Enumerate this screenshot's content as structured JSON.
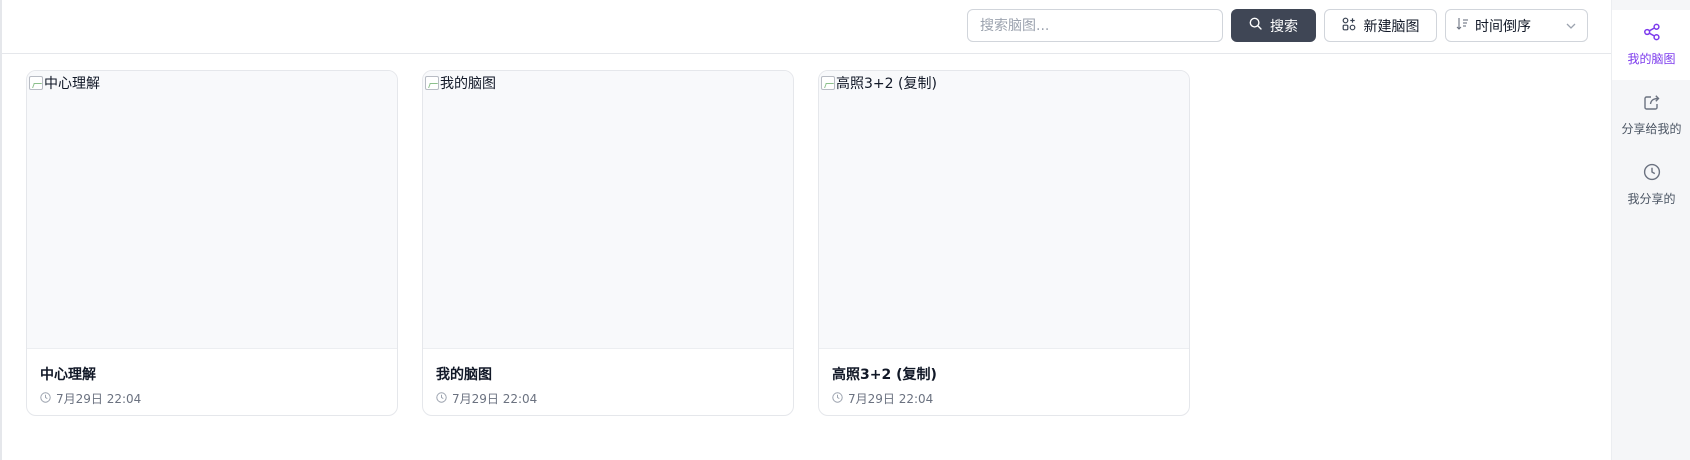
{
  "toolbar": {
    "search_placeholder": "搜索脑图...",
    "search_label": "搜索",
    "new_label": "新建脑图",
    "sort_value": "时间倒序"
  },
  "cards": [
    {
      "alt": "中心理解",
      "title": "中心理解",
      "date": "7月29日 22:04"
    },
    {
      "alt": "我的脑图",
      "title": "我的脑图",
      "date": "7月29日 22:04"
    },
    {
      "alt": "高照3+2 (复制)",
      "title": "高照3+2 (复制)",
      "date": "7月29日 22:04"
    }
  ],
  "sidebar": {
    "items": [
      {
        "label": "我的脑图",
        "icon": "share-nodes-icon",
        "active": true
      },
      {
        "label": "分享给我的",
        "icon": "share-arrow-icon",
        "active": false
      },
      {
        "label": "我分享的",
        "icon": "clock-icon",
        "active": false
      }
    ]
  },
  "colors": {
    "accent": "#7c3aed",
    "primary_button": "#3f4655",
    "border": "#e5e7eb"
  }
}
